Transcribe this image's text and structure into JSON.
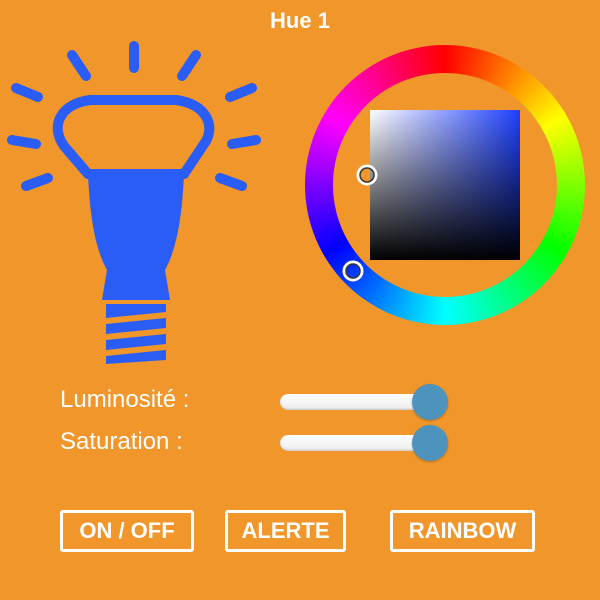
{
  "title": "Hue 1",
  "colors": {
    "background": "#f0962a",
    "bulb": "#2a5cf6",
    "text": "#ffffff",
    "slider_thumb": "#4c93bd"
  },
  "icons": {
    "bulb": "light-bulb-icon"
  },
  "color_picker": {
    "hue_marker_hex": "#2f3cff",
    "sv_marker_hex": "#1e40ff"
  },
  "sliders": [
    {
      "label": "Luminosité :",
      "value": 1.0
    },
    {
      "label": "Saturation :",
      "value": 1.0
    }
  ],
  "buttons": [
    {
      "label": "ON / OFF"
    },
    {
      "label": "ALERTE"
    },
    {
      "label": "RAINBOW"
    }
  ]
}
